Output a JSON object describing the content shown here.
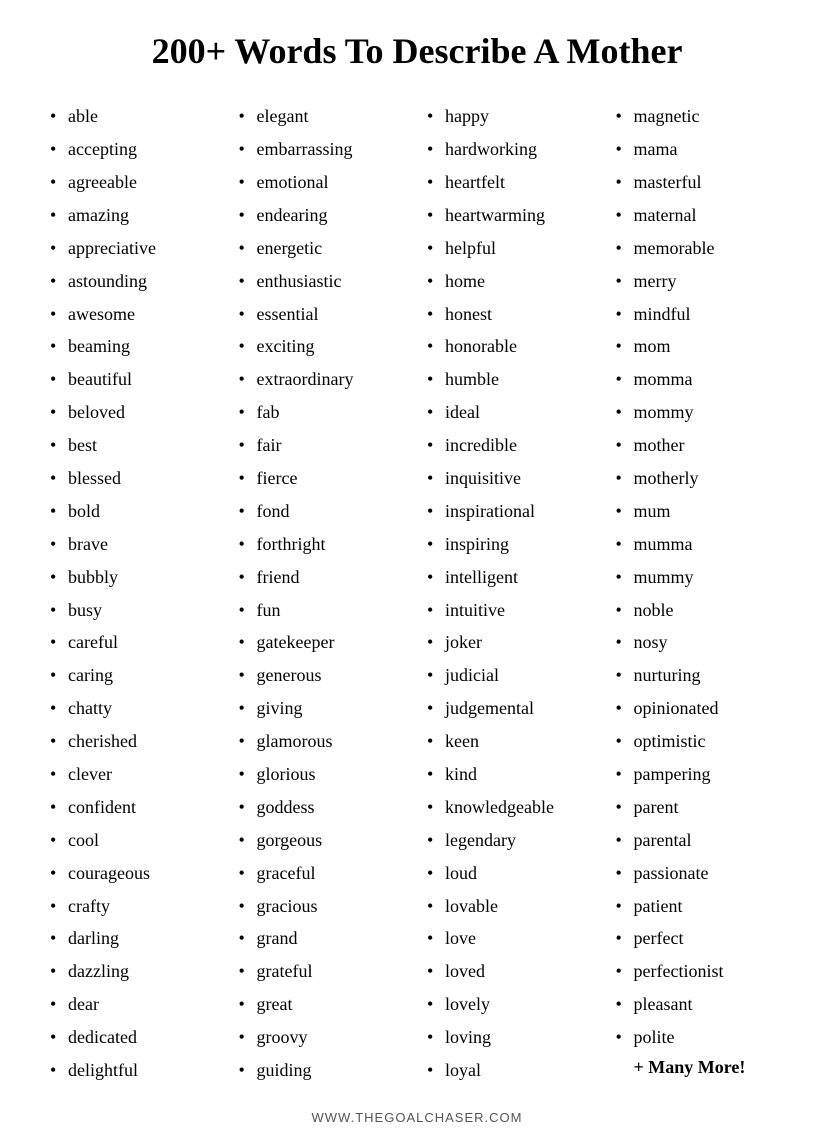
{
  "title": "200+ Words To Describe A Mother",
  "columns": [
    {
      "id": "col1",
      "words": [
        "able",
        "accepting",
        "agreeable",
        "amazing",
        "appreciative",
        "astounding",
        "awesome",
        "beaming",
        "beautiful",
        "beloved",
        "best",
        "blessed",
        "bold",
        "brave",
        "bubbly",
        "busy",
        "careful",
        "caring",
        "chatty",
        "cherished",
        "clever",
        "confident",
        "cool",
        "courageous",
        "crafty",
        "darling",
        "dazzling",
        "dear",
        "dedicated",
        "delightful"
      ]
    },
    {
      "id": "col2",
      "words": [
        "elegant",
        "embarrassing",
        "emotional",
        "endearing",
        "energetic",
        "enthusiastic",
        "essential",
        "exciting",
        "extraordinary",
        "fab",
        "fair",
        "fierce",
        "fond",
        "forthright",
        "friend",
        "fun",
        "gatekeeper",
        "generous",
        "giving",
        "glamorous",
        "glorious",
        "goddess",
        "gorgeous",
        "graceful",
        "gracious",
        "grand",
        "grateful",
        "great",
        "groovy",
        "guiding"
      ]
    },
    {
      "id": "col3",
      "words": [
        "happy",
        "hardworking",
        "heartfelt",
        "heartwarming",
        "helpful",
        "home",
        "honest",
        "honorable",
        "humble",
        " ideal",
        "incredible",
        "inquisitive",
        "inspirational",
        "inspiring",
        "intelligent",
        "intuitive",
        "joker",
        "judicial",
        "judgemental",
        "keen",
        "kind",
        "knowledgeable",
        "legendary",
        "loud",
        "lovable",
        "love",
        "loved",
        "lovely",
        "loving",
        "loyal"
      ]
    },
    {
      "id": "col4",
      "words": [
        "magnetic",
        "mama",
        "masterful",
        "maternal",
        "memorable",
        "merry",
        "mindful",
        "mom",
        "momma",
        "mommy",
        "mother",
        "motherly",
        "mum",
        "mumma",
        "mummy",
        "noble",
        "nosy",
        "nurturing",
        "opinionated",
        "optimistic",
        "pampering",
        "parent",
        "parental",
        "passionate",
        "patient",
        "perfect",
        "perfectionist",
        "pleasant",
        "polite"
      ]
    }
  ],
  "many_more": "+ Many More!",
  "footer": "WWW.THEGOALCHASER.COM"
}
